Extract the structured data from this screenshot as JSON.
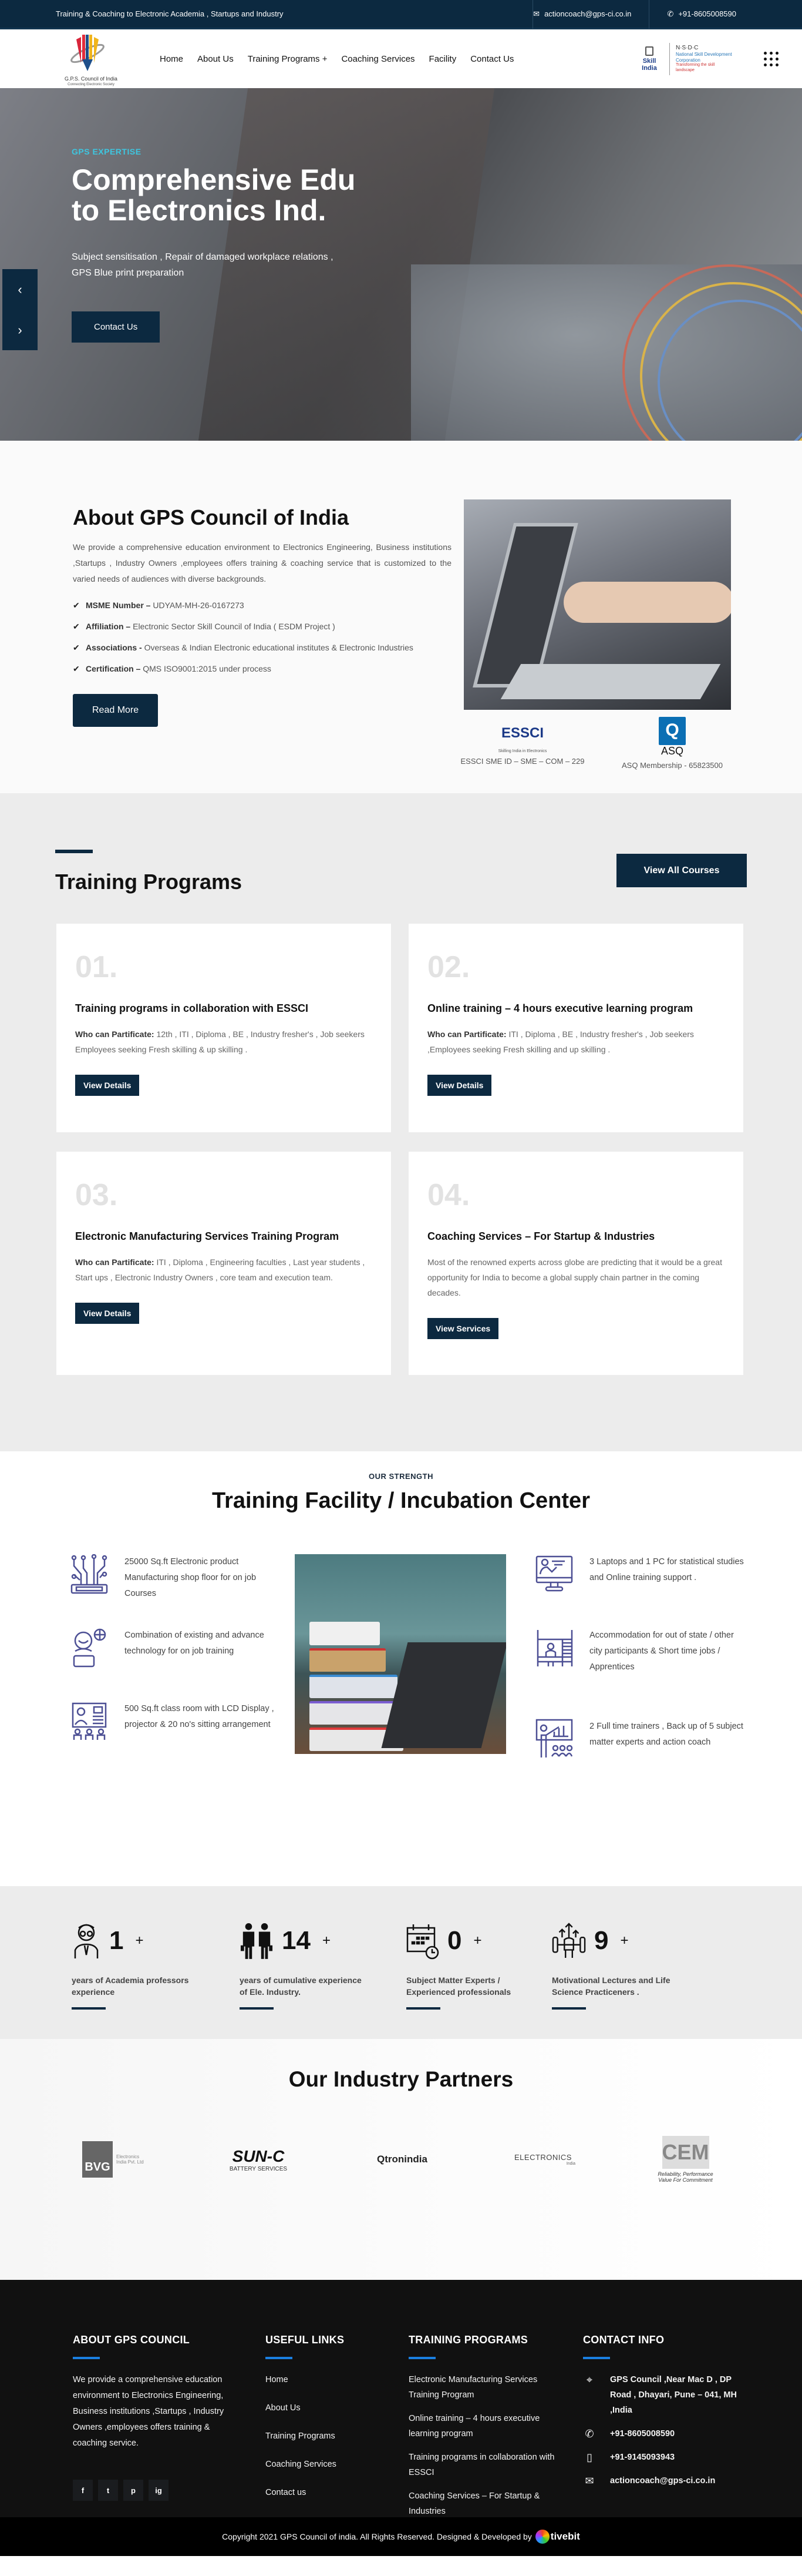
{
  "topbar": {
    "tagline": "Training & Coaching to Electronic Academia , Startups and Industry",
    "email": "actioncoach@gps-ci.co.in",
    "phone": "+91-8605008590"
  },
  "header": {
    "logo_title": "G.P.S. Council of India",
    "logo_subtitle": "Connecting Electronic Society",
    "nav": [
      "Home",
      "About Us",
      "Training Programs +",
      "Coaching Services",
      "Facility",
      "Contact Us"
    ],
    "partner_logo_1": "Skill India",
    "partner_logo_2_title": "N·S·D·C",
    "partner_logo_2_body": "National Skill Development Corporation",
    "partner_logo_2_tag": "Transforming the skill landscape"
  },
  "hero": {
    "kicker": "GPS EXPERTISE",
    "title_line1": "Comprehensive Edu",
    "title_line2": "to Electronics Ind.",
    "subtitle": "Subject sensitisation , Repair of damaged workplace relations , GPS Blue print preparation",
    "cta": "Contact Us",
    "prev": "‹",
    "next": "›"
  },
  "about": {
    "title": "About GPS Council of India",
    "intro": "We provide a comprehensive education environment to Electronics Engineering, Business institutions ,Startups , Industry Owners ,employees offers training & coaching service that is customized to the varied needs of audiences with diverse backgrounds.",
    "facts": [
      {
        "label": "MSME Number –",
        "value": " UDYAM-MH-26-0167273"
      },
      {
        "label": "Affiliation –",
        "value": " Electronic Sector Skill Council of India ( ESDM Project )"
      },
      {
        "label": "Associations -",
        "value": " Overseas & Indian Electronic educational institutes & Electronic Industries"
      },
      {
        "label": "Certification –",
        "value": " QMS ISO9001:2015 under process"
      }
    ],
    "read_more": "Read More",
    "cert_1_logo": "ESSCI",
    "cert_1_tag": "Skilling India in Electronics",
    "cert_1_label": "ESSCI SME ID – SME – COM – 229",
    "cert_2_logo": "ASQ",
    "cert_2_label": "ASQ Membership - 65823500"
  },
  "training": {
    "title": "Training Programs",
    "view_all": "View All Courses",
    "cards": [
      {
        "num": "01.",
        "title": "Training programs in collaboration with ESSCI",
        "who_label": "Who can Partificate:",
        "who": " 12th , ITI , Diploma , BE , Industry fresher's , Job seekers Employees seeking Fresh skilling & up skilling .",
        "button": "View Details"
      },
      {
        "num": "02.",
        "title": "Online training – 4 hours executive learning program",
        "who_label": "Who can Partificate:",
        "who": " ITI , Diploma , BE , Industry fresher's , Job seekers ,Employees seeking Fresh skilling and up skilling .",
        "button": "View Details"
      },
      {
        "num": "03.",
        "title": "Electronic Manufacturing Services Training Program",
        "who_label": "Who can Partificate:",
        "who": " ITI , Diploma , Engineering faculties , Last year students , Start ups , Electronic Industry Owners , core team and execution team.",
        "button": "View Details"
      },
      {
        "num": "04.",
        "title": "Coaching Services – For Startup & Industries",
        "who_label": "",
        "who": "Most of the renowned experts across globe are predicting that it would be a great opportunity for India to become a global supply chain partner in the coming decades.",
        "button": "View Services"
      }
    ]
  },
  "facility": {
    "kicker": "OUR STRENGTH",
    "title": "Training Facility / Incubation Center",
    "items": [
      {
        "icon": "circuit-board-icon",
        "text": "25000 Sq.ft Electronic product Manufacturing shop floor for on job Courses"
      },
      {
        "icon": "tech-person-icon",
        "text": "Combination of existing and advance technology for on job training"
      },
      {
        "icon": "classroom-icon",
        "text": "500 Sq.ft class room with LCD Display , projector & 20 no's sitting arrangement"
      },
      {
        "icon": "monitor-presenter-icon",
        "text": "3 Laptops and 1 PC for statistical studies and Online training support ."
      },
      {
        "icon": "bunk-bed-icon",
        "text": "Accommodation for out of state / other city participants & Short time jobs / Apprentices"
      },
      {
        "icon": "trainer-chart-icon",
        "text": "2 Full time trainers , Back up of 5 subject matter experts and action coach"
      }
    ]
  },
  "stats": [
    {
      "icon": "professor-icon",
      "value": "1",
      "suffix": "+",
      "label": "years of Academia professors experience"
    },
    {
      "icon": "businessmen-icon",
      "value": "14",
      "suffix": "+",
      "label": "years of cumulative experience of Ele. Industry."
    },
    {
      "icon": "calendar-clock-icon",
      "value": "0",
      "suffix": "+",
      "label": "Subject Matter Experts / Experienced professionals"
    },
    {
      "icon": "strength-growth-icon",
      "value": "9",
      "suffix": "+",
      "label": "Motivational Lectures and Life Science Practiceners ."
    }
  ],
  "partners": {
    "title": "Our Industry Partners",
    "logos": [
      {
        "name": "BVG",
        "sub": "Electronics India Pvt. Ltd"
      },
      {
        "name": "SUN-C",
        "sub": "BATTERY SERVICES"
      },
      {
        "name": "Qtronindia",
        "sub": ""
      },
      {
        "name": "ELECTRONICS",
        "sub": "India"
      },
      {
        "name": "CEM",
        "sub": "Reliability, Performance Value For Commitment"
      }
    ]
  },
  "footer": {
    "about_title": "ABOUT GPS COUNCIL",
    "about_text": "We provide a comprehensive education environment to Electronics Engineering, Business institutions ,Startups , Industry Owners ,employees offers training & coaching service.",
    "social": [
      "f",
      "t",
      "p",
      "ig"
    ],
    "links_title": "USEFUL LINKS",
    "links": [
      "Home",
      "About Us",
      "Training Programs",
      "Coaching Services",
      "Contact us"
    ],
    "programs_title": "TRAINING PROGRAMS",
    "programs": [
      "Electronic Manufacturing Services Training Program",
      "Online training – 4 hours executive learning program",
      "Training programs in collaboration with ESSCI",
      "Coaching Services – For Startup & Industries"
    ],
    "contact_title": "CONTACT INFO",
    "address": "GPS Council ,Near Mac D , DP Road , Dhayari, Pune – 041, MH ,India",
    "phone1": "+91-8605008590",
    "phone2": "+91-9145093943",
    "email": "actioncoach@gps-ci.co.in",
    "copyright": "Copyright 2021 GPS Council of india. All Rights Reserved. Designed & Developed by",
    "developer": "tivebit"
  },
  "colors": {
    "navy": "#0c2940",
    "accent_cyan": "#3ec6e0",
    "footer_accent": "#1b7fe0",
    "icon_purple": "#4c4f94"
  }
}
